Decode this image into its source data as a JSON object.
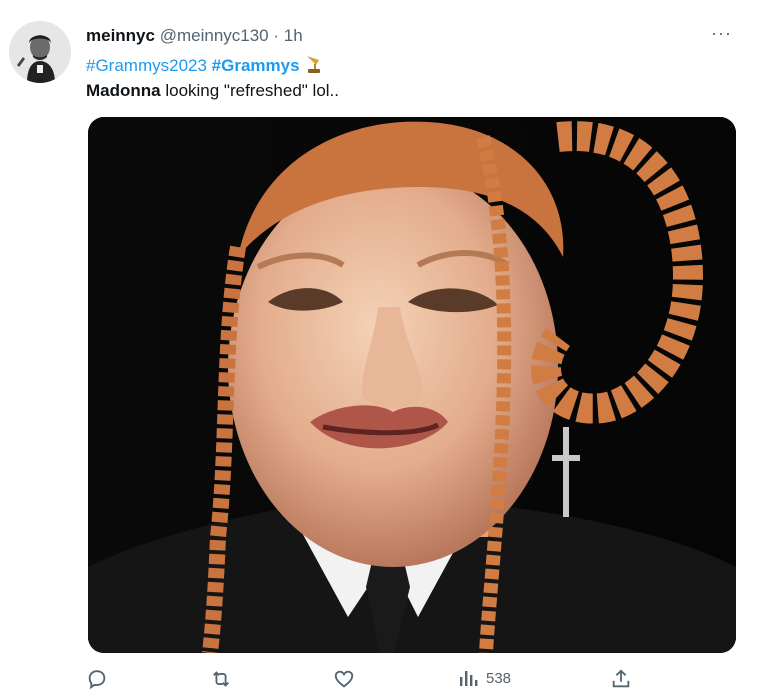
{
  "tweet": {
    "author": {
      "display_name": "meinnyc",
      "handle": "@meinnyc130",
      "separator": "·",
      "time": "1h"
    },
    "hashtags": [
      {
        "text": "#Grammys2023",
        "bold": false
      },
      {
        "text": "#Grammys",
        "bold": true
      }
    ],
    "text": {
      "bold": "Madonna",
      "rest": " looking \"refreshed\" lol.."
    },
    "more_label": "···",
    "stats": {
      "views": "538"
    }
  },
  "colors": {
    "link": "#1d9bf0",
    "muted": "#536471",
    "text": "#0f1419"
  },
  "icons": {
    "more": "more-dots-icon",
    "reply": "reply-icon",
    "retweet": "retweet-icon",
    "like": "heart-icon",
    "views": "views-bar-chart-icon",
    "share": "share-icon",
    "hashtag_emoji": "gramophone-icon"
  }
}
